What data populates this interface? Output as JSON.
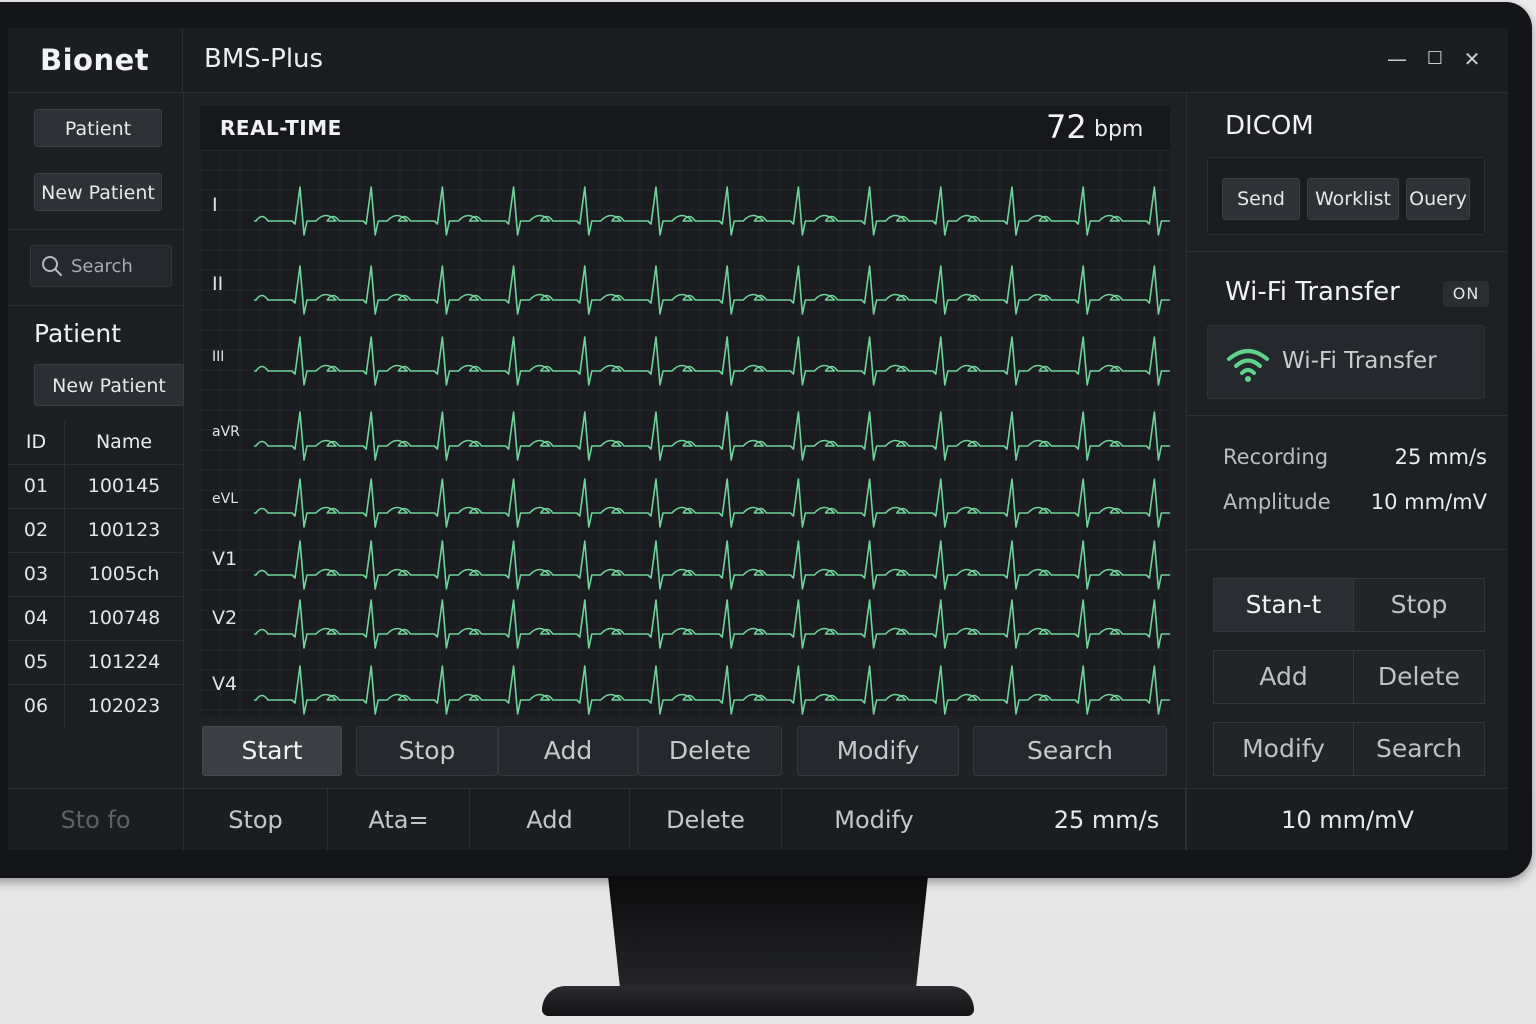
{
  "app": {
    "brand": "Bionet",
    "title": "BMS-Plus",
    "window_controls": {
      "minimize": "—",
      "maximize": "☐",
      "close": "✕"
    }
  },
  "sidebar": {
    "patient_button": "Patient",
    "new_patient_button": "New Patient",
    "search_placeholder": "Search",
    "section_title": "Patient",
    "section_new_patient": "New Patient",
    "table": {
      "columns": [
        "ID",
        "Name"
      ],
      "rows": [
        {
          "id": "01",
          "name": "100145"
        },
        {
          "id": "02",
          "name": "100123"
        },
        {
          "id": "03",
          "name": "1005ch"
        },
        {
          "id": "04",
          "name": "100748"
        },
        {
          "id": "05",
          "name": "101224"
        },
        {
          "id": "06",
          "name": "102023"
        }
      ]
    }
  },
  "ecg": {
    "label": "REAL-TIME",
    "heart_rate": "72",
    "heart_rate_unit": "bpm",
    "leads": [
      "I",
      "II",
      "III",
      "aVR",
      "eVL",
      "V1",
      "V2",
      "V4"
    ],
    "trace_color": "#6fd39a",
    "grid_color": "#23282b"
  },
  "actions": {
    "start": "Start",
    "stop": "Stop",
    "add": "Add",
    "delete": "Delete",
    "modify": "Modify",
    "search": "Search"
  },
  "statusbar": {
    "left": "Sto fo",
    "stop": "Stop",
    "ata": "Ata=",
    "add": "Add",
    "delete": "Delete",
    "modify": "Modify",
    "speed": "25 mm/s",
    "amplitude": "10 mm/mV"
  },
  "right_panel": {
    "dicom": {
      "title": "DICOM",
      "send": "Send",
      "worklist": "Worklist",
      "query": "Ouery"
    },
    "wifi": {
      "title": "Wi-Fi Transfer",
      "status": "ON",
      "box_label": "Wi-Fi Transfer",
      "icon_color": "#5fd38c"
    },
    "settings": {
      "recording_label": "Recording",
      "recording_value": "25 mm/s",
      "amplitude_label": "Amplitude",
      "amplitude_value": "10 mm/mV"
    },
    "buttons": {
      "start": "Stan‑t",
      "stop": "Stop",
      "add": "Add",
      "delete": "Delete",
      "modify": "Modify",
      "search": "Search"
    }
  }
}
